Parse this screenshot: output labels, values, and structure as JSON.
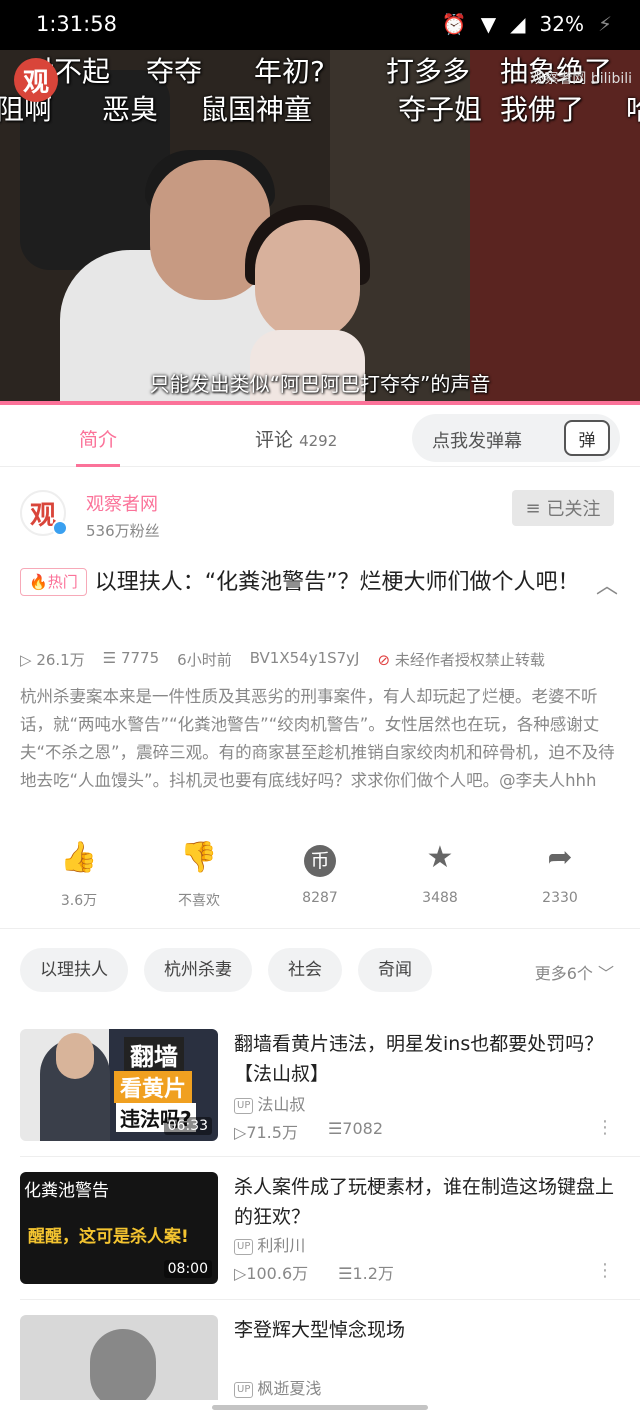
{
  "status_bar": {
    "time": "1:31:58",
    "battery": "32%"
  },
  "player": {
    "danmaku_row1": [
      "对不起",
      "夺夺",
      "年初?",
      "打多多",
      "抽象绝了"
    ],
    "danmaku_row2": [
      "阻啊",
      "恶臭",
      "鼠国神童",
      "夺子姐",
      "我佛了",
      "哈"
    ],
    "logo_char": "观",
    "watermark": "观察者网 bilibili",
    "subtitle": "只能发出类似“阿巴阿巴打夺夺”的声音"
  },
  "tabs": {
    "intro": "简介",
    "comments": "评论",
    "comments_count": "4292",
    "danmu_placeholder": "点我发弹幕",
    "danmu_icon_char": "弹"
  },
  "uploader": {
    "avatar_char": "观",
    "name": "观察者网",
    "fans": "536万粉丝",
    "follow_label": "已关注"
  },
  "video": {
    "hot_badge": "热门",
    "title": "以理扶人：“化粪池警告”？烂梗大师们做个人吧！",
    "views": "26.1万",
    "danmaku_count": "7775",
    "time_ago": "6小时前",
    "bvid": "BV1X54y1S7yJ",
    "repost_notice": "未经作者授权禁止转载",
    "description": "杭州杀妻案本来是一件性质及其恶劣的刑事案件，有人却玩起了烂梗。老婆不听话，就“两吨水警告”“化粪池警告”“绞肉机警告”。女性居然也在玩，各种感谢丈夫“不杀之恩”，震碎三观。有的商家甚至趁机推销自家绞肉机和碎骨机，迫不及待地去吃“人血馒头”。抖机灵也要有底线好吗？求求你们做个人吧。@李夫人hhh"
  },
  "actions": [
    {
      "icon": "thumbs-up-icon",
      "label": "3.6万"
    },
    {
      "icon": "thumbs-down-icon",
      "label": "不喜欢"
    },
    {
      "icon": "coin-icon",
      "label": "8287"
    },
    {
      "icon": "star-icon",
      "label": "3488"
    },
    {
      "icon": "share-icon",
      "label": "2330"
    }
  ],
  "tags": [
    "以理扶人",
    "杭州杀妻",
    "社会",
    "奇闻"
  ],
  "tags_more": "更多6个",
  "recommendations": [
    {
      "title": "翻墙看黄片违法，明星发ins也都要处罚吗？【法山叔】",
      "up": "法山叔",
      "views": "71.5万",
      "danmaku": "7082",
      "duration": "06:33",
      "thumb_text1": "翻墙",
      "thumb_text2": "看黄片",
      "thumb_text3": "违法吗?"
    },
    {
      "title": "杀人案件成了玩梗素材，谁在制造这场键盘上的狂欢？",
      "up": "利利川",
      "views": "100.6万",
      "danmaku": "1.2万",
      "duration": "08:00",
      "thumb_text1": "化粪池警告",
      "thumb_text2": "醒醒，这可是杀人案!"
    },
    {
      "title": "李登辉大型悼念现场",
      "up": "枫逝夏浅"
    }
  ],
  "up_badge": "UP",
  "colors": {
    "accent": "#fb7299",
    "status_bar": "#000000"
  }
}
